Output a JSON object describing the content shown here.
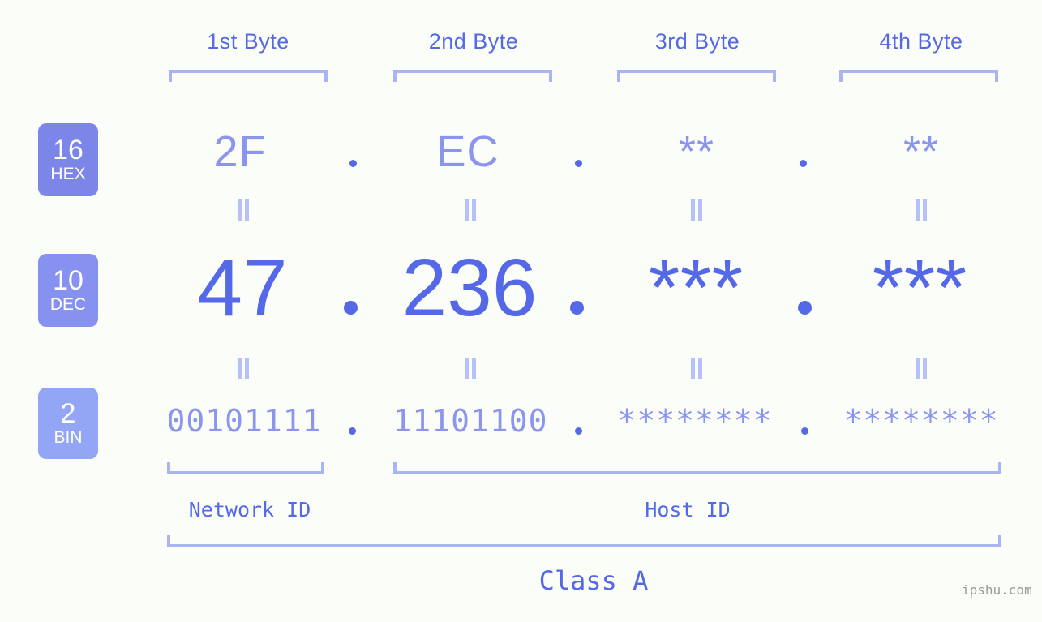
{
  "meta": {
    "background_color": "#fbfdf8",
    "accent_color": "#5468e8",
    "muted_accent_color": "#8b95ee",
    "bracket_color": "#aab4f5",
    "watermark": "ipshu.com"
  },
  "byte_headers": [
    {
      "label": "1st Byte"
    },
    {
      "label": "2nd Byte"
    },
    {
      "label": "3rd Byte"
    },
    {
      "label": "4th Byte"
    }
  ],
  "bases": [
    {
      "number": "16",
      "name": "HEX",
      "color": "#7b86e8"
    },
    {
      "number": "10",
      "name": "DEC",
      "color": "#8691f0"
    },
    {
      "number": "2",
      "name": "BIN",
      "color": "#92a6f5"
    }
  ],
  "rows": {
    "hex": {
      "values": [
        "2F",
        "EC",
        "**",
        "**"
      ]
    },
    "dec": {
      "values": [
        "47",
        "236",
        "***",
        "***"
      ]
    },
    "bin": {
      "values": [
        "00101111",
        "11101100",
        "********",
        "********"
      ]
    }
  },
  "separators": {
    "dot": ".",
    "equals": "="
  },
  "segments": {
    "network_id": {
      "label": "Network ID"
    },
    "host_id": {
      "label": "Host ID"
    },
    "class": {
      "label": "Class A"
    }
  }
}
